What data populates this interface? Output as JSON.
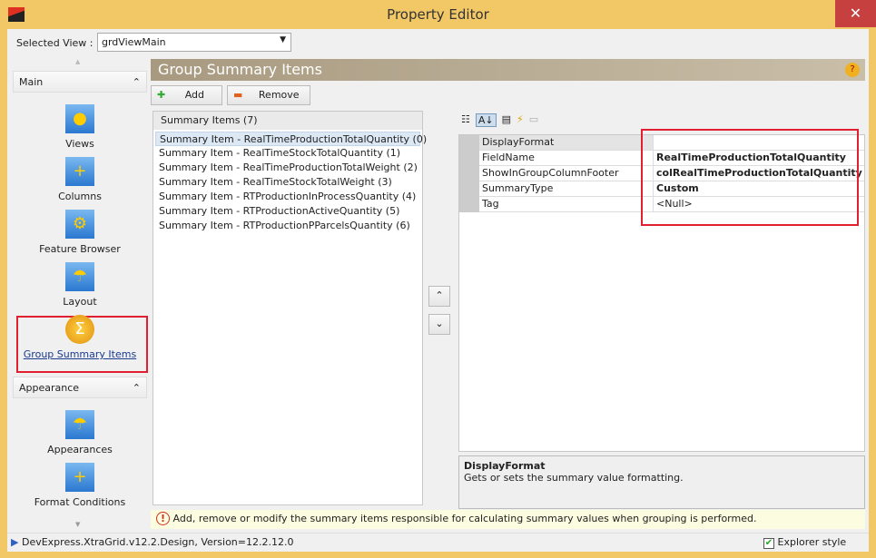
{
  "window": {
    "title": "Property Editor",
    "close": "✕"
  },
  "selected_view": {
    "label": "Selected View :",
    "value": "grdViewMain"
  },
  "nav": {
    "groups": [
      {
        "label": "Main",
        "items": [
          "Views",
          "Columns",
          "Feature Browser",
          "Layout",
          "Group Summary Items"
        ]
      },
      {
        "label": "Appearance",
        "items": [
          "Appearances",
          "Format Conditions"
        ]
      }
    ],
    "selected": "Group Summary Items"
  },
  "header": {
    "title": "Group Summary Items"
  },
  "toolbar": {
    "add": "Add",
    "remove": "Remove"
  },
  "summary_list": {
    "header": "Summary Items (7)",
    "items": [
      "Summary Item - RealTimeProductionTotalQuantity (0)",
      "Summary Item - RealTimeStockTotalQuantity (1)",
      "Summary Item - RealTimeProductionTotalWeight (2)",
      "Summary Item - RealTimeStockTotalWeight (3)",
      "Summary Item - RTProductionInProcessQuantity (4)",
      "Summary Item - RTProductionActiveQuantity (5)",
      "Summary Item - RTProductionPParcelsQuantity (6)"
    ],
    "selected_index": 0
  },
  "properties": [
    {
      "name": "DisplayFormat",
      "value": "",
      "bold": false
    },
    {
      "name": "FieldName",
      "value": "RealTimeProductionTotalQuantity",
      "bold": true
    },
    {
      "name": "ShowInGroupColumnFooter",
      "value": "colRealTimeProductionTotalQuantity",
      "bold": true
    },
    {
      "name": "SummaryType",
      "value": "Custom",
      "bold": true
    },
    {
      "name": "Tag",
      "value": "<Null>",
      "bold": false
    }
  ],
  "description": {
    "title": "DisplayFormat",
    "text": "Gets or sets the summary value formatting."
  },
  "hint": "Add, remove or modify the summary items responsible for calculating summary values when grouping is performed.",
  "status": {
    "text": "DevExpress.XtraGrid.v12.2.Design, Version=12.2.12.0",
    "explorer_style": "Explorer style",
    "explorer_checked": true
  }
}
